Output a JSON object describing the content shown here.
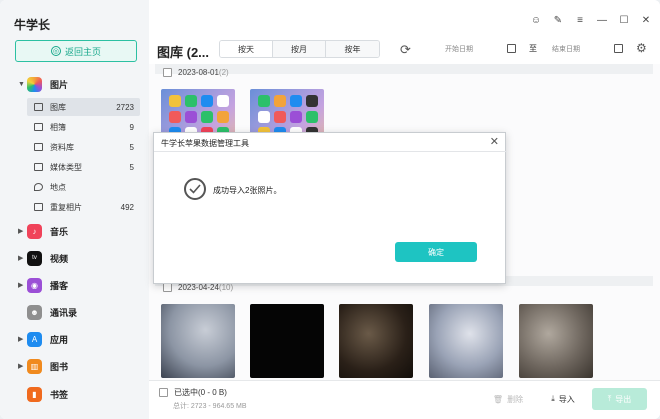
{
  "app": {
    "title": "牛学长"
  },
  "sidebar": {
    "home_label": "返回主页",
    "categories": [
      {
        "label": "图片",
        "icon": "photos-icon",
        "color": "#f2a33a"
      },
      {
        "label": "音乐",
        "icon": "music-icon",
        "color": "#f0435a"
      },
      {
        "label": "视频",
        "icon": "tv-icon",
        "color": "#111111"
      },
      {
        "label": "播客",
        "icon": "podcast-icon",
        "color": "#9b4fd6"
      },
      {
        "label": "通讯录",
        "icon": "contacts-icon",
        "color": "#8f8f8f"
      },
      {
        "label": "应用",
        "icon": "appstore-icon",
        "color": "#1e8cf0"
      },
      {
        "label": "图书",
        "icon": "books-icon",
        "color": "#f08a1e"
      },
      {
        "label": "书签",
        "icon": "bookmarks-icon",
        "color": "#f06a1e"
      }
    ],
    "photo_sub": [
      {
        "label": "图库",
        "count": "2723"
      },
      {
        "label": "相簿",
        "count": "9"
      },
      {
        "label": "资料库",
        "count": "5"
      },
      {
        "label": "媒体类型",
        "count": "5"
      },
      {
        "label": "地点",
        "count": ""
      },
      {
        "label": "重复相片",
        "count": "492"
      }
    ]
  },
  "toolbar": {
    "title": "图库 (2...",
    "tabs": [
      "按天",
      "按月",
      "按年"
    ],
    "start_placeholder": "开始日期",
    "to_label": "至",
    "end_placeholder": "结束日期"
  },
  "groups": [
    {
      "date": "2023-08-01",
      "count": "(2)"
    },
    {
      "date": "2023-04-24",
      "count": "(10)"
    }
  ],
  "bottom": {
    "selected": "已选中(0 - 0 B)",
    "total": "总计: 2723 - 964.65 MB",
    "delete": "删除",
    "import": "导入",
    "export": "导出"
  },
  "modal": {
    "title": "牛学长苹果数据管理工具",
    "message": "成功导入2张照片。",
    "ok": "确定"
  }
}
